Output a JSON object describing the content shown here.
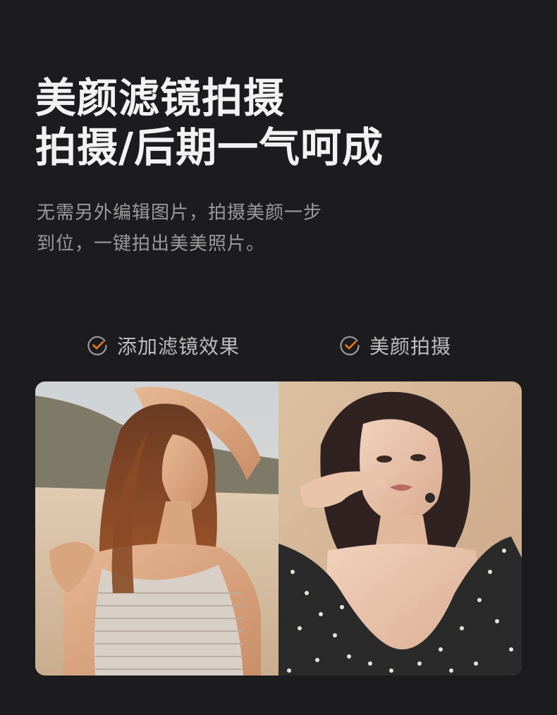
{
  "headline": {
    "line1": "美颜滤镜拍摄",
    "line2": "拍摄/后期一气呵成"
  },
  "subtitle": {
    "line1": "无需另外编辑图片，拍摄美颜一步",
    "line2": "到位，一键拍出美美照片。"
  },
  "features": [
    {
      "label": "添加滤镜效果",
      "icon": "check-circle-icon"
    },
    {
      "label": "美颜拍摄",
      "icon": "check-circle-icon"
    }
  ],
  "colors": {
    "background": "#1c1c1e",
    "accent": "#f07a1a",
    "headline": "#f2f2f2",
    "subtitle": "#9a9a9a"
  }
}
